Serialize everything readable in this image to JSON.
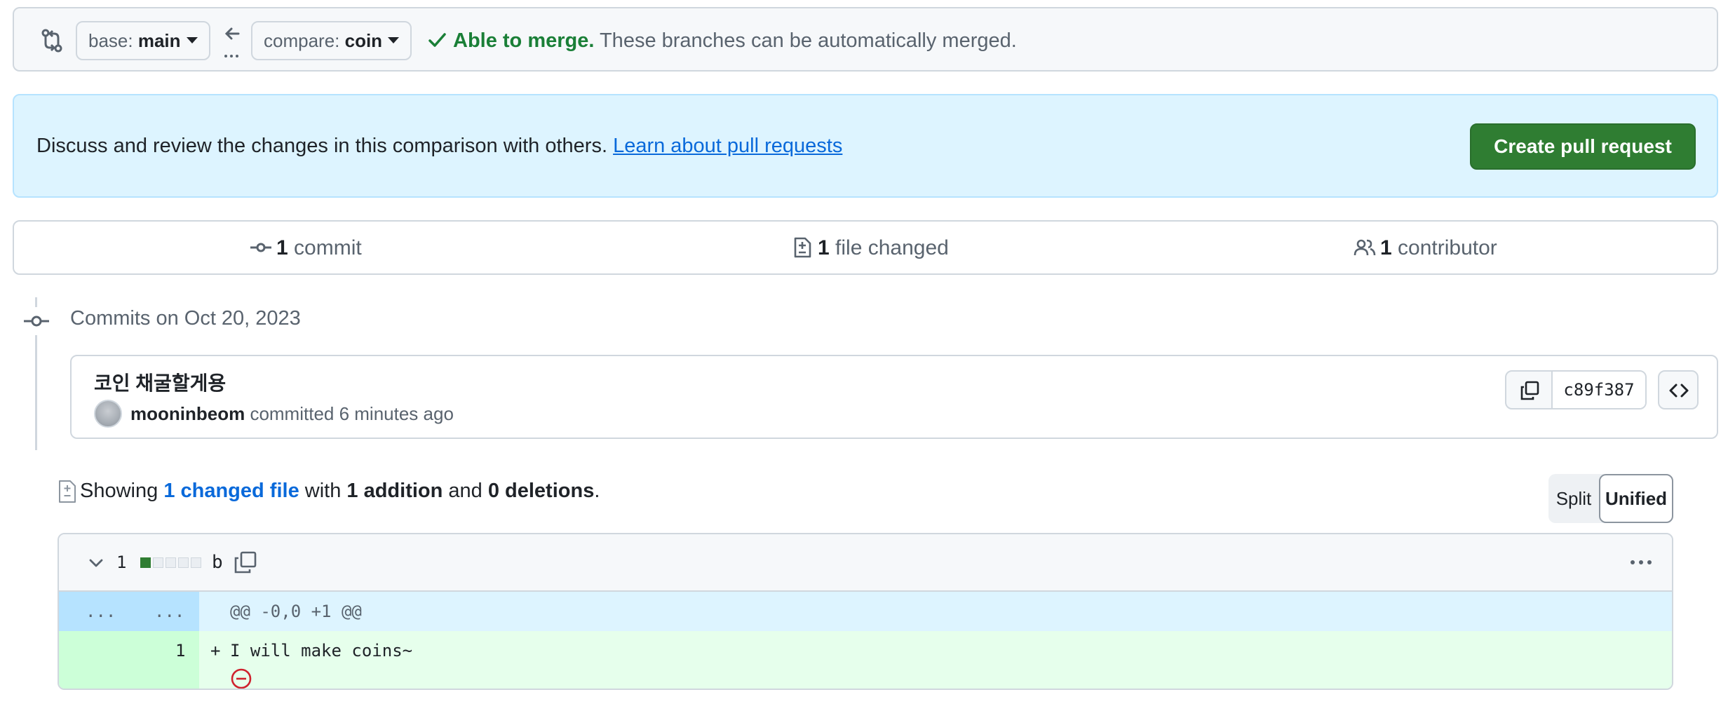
{
  "range": {
    "base_prefix": "base: ",
    "base_branch": "main",
    "compare_prefix": "compare: ",
    "compare_branch": "coin",
    "merge_status": "Able to merge.",
    "merge_message": " These branches can be automatically merged."
  },
  "flash": {
    "text": "Discuss and review the changes in this comparison with others. ",
    "link": "Learn about pull requests",
    "create_button": "Create pull request"
  },
  "summary": {
    "commits_count": "1",
    "commits_label": " commit",
    "files_count": "1",
    "files_label": " file changed",
    "contributors_count": "1",
    "contributors_label": " contributor"
  },
  "commits": {
    "date_heading": "Commits on Oct 20, 2023",
    "items": [
      {
        "title": "코인 채굴할게용",
        "author": "mooninbeom",
        "action": " committed 6 minutes ago",
        "sha": "c89f387"
      }
    ]
  },
  "toc": {
    "prefix": "Showing ",
    "changed_link": "1 changed file",
    "mid1": " with ",
    "additions": "1 addition",
    "mid2": " and ",
    "deletions": "0 deletions",
    "suffix": ".",
    "split_label": "Split",
    "unified_label": "Unified"
  },
  "diff": {
    "change_count": "1",
    "file_name": "b",
    "diffstat": {
      "added_blocks": 1,
      "total_blocks": 5
    },
    "hunk_expand_left": "...",
    "hunk_expand_right": "...",
    "hunk_header": "@@ -0,0 +1 @@",
    "lines": [
      {
        "new_num": "1",
        "sign": "+",
        "text": "I will make coins~"
      }
    ]
  },
  "colors": {
    "accent_blue": "#0969da",
    "success_green": "#1a7f37",
    "button_green": "#2f7d32",
    "danger_red": "#cf222e"
  },
  "icons": {
    "range": "git-compare-icon",
    "arrow": "arrow-left-icon",
    "check": "check-icon",
    "commit": "git-commit-icon",
    "file_diff": "file-diff-icon",
    "people": "people-icon",
    "copy": "copy-icon",
    "browse": "code-icon",
    "chevron": "chevron-down-icon",
    "kebab": "kebab-horizontal-icon",
    "no_newline": "no-entry-icon"
  }
}
